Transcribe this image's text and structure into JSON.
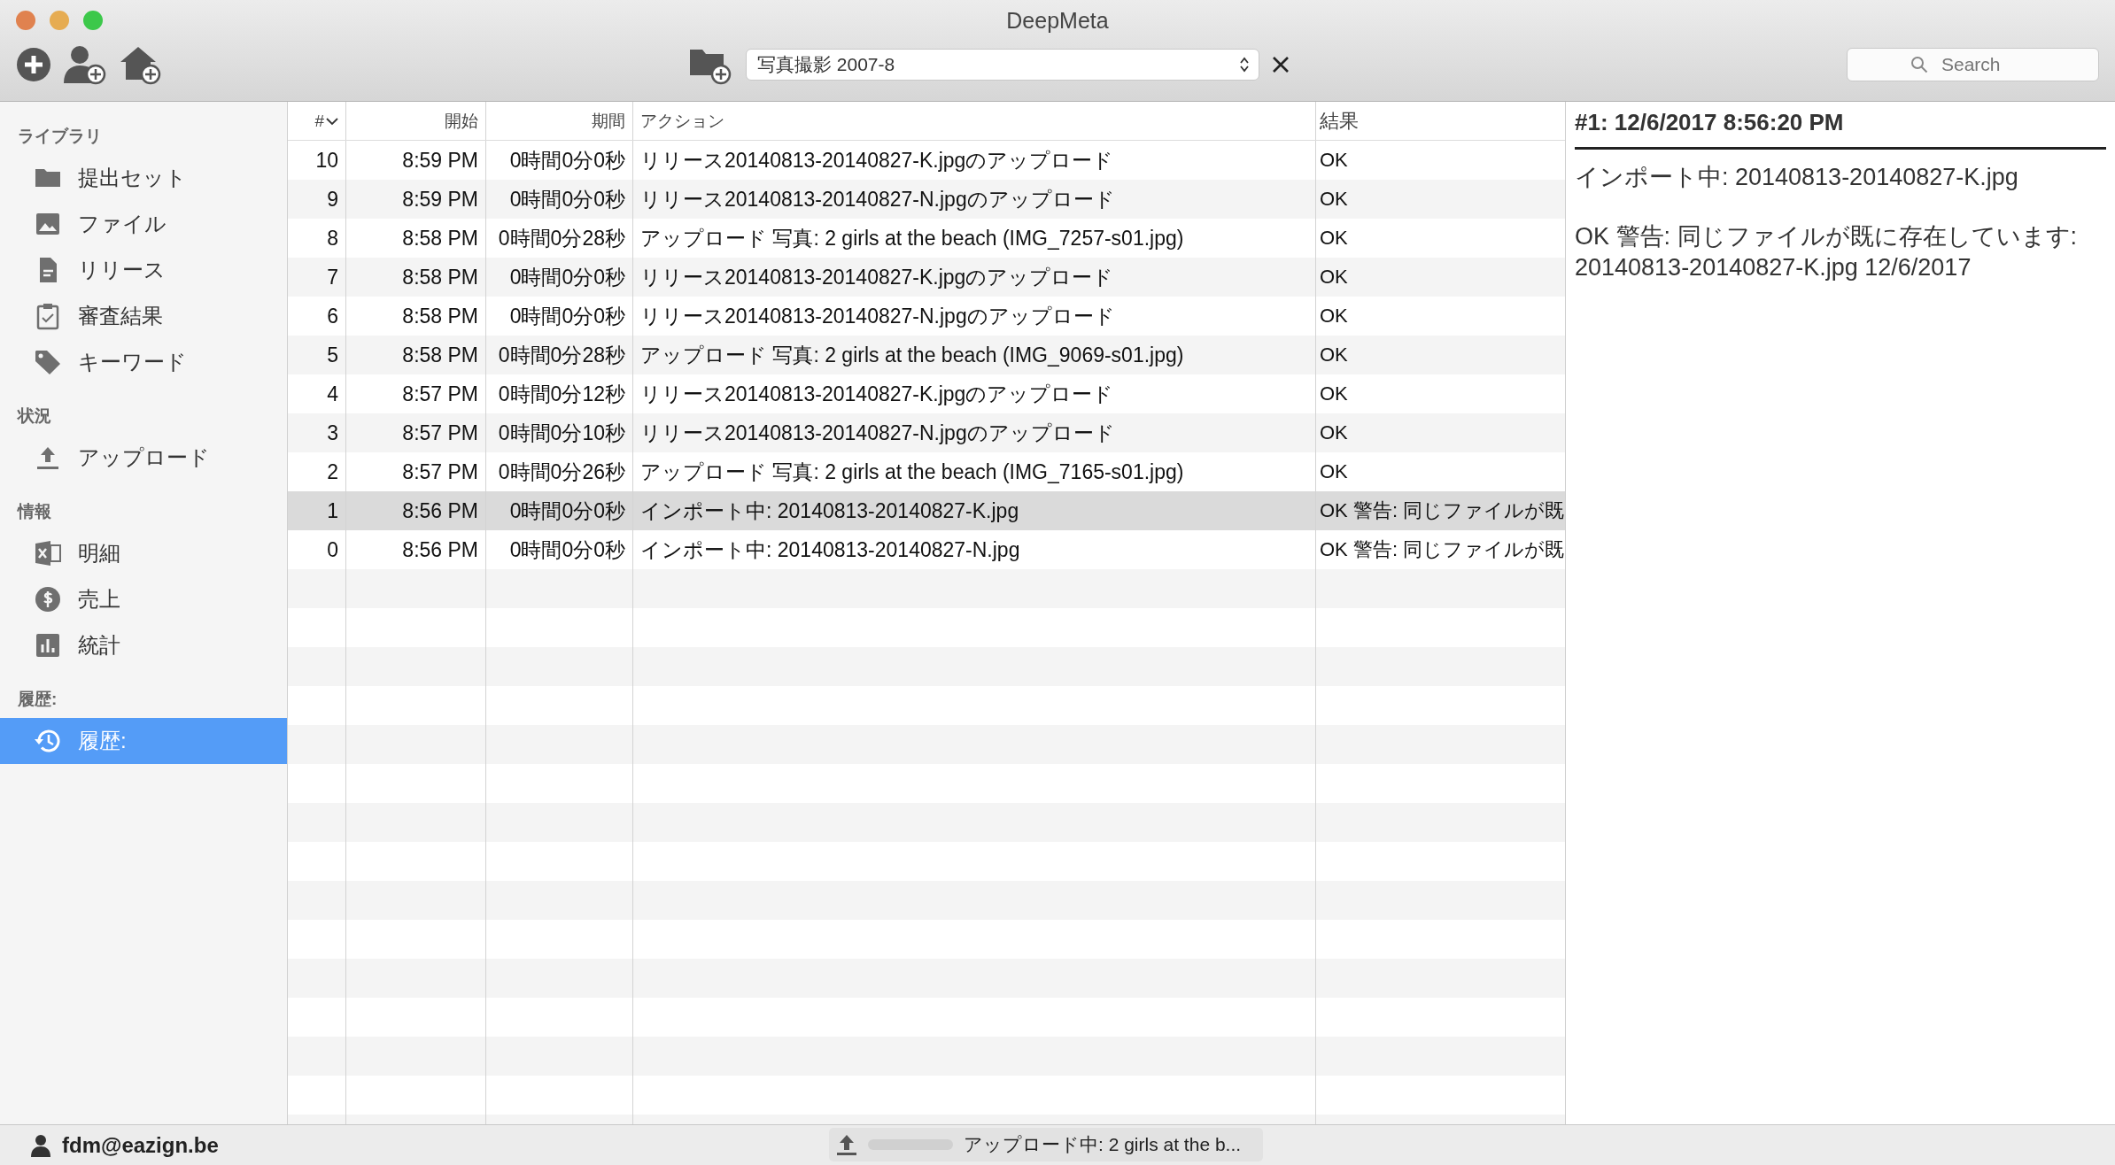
{
  "window": {
    "title": "DeepMeta"
  },
  "toolbar": {
    "collection": "写真撮影 2007-8",
    "search": {
      "placeholder": "Search"
    }
  },
  "sidebar": {
    "sections": [
      {
        "title": "ライブラリ",
        "items": [
          {
            "label": "提出セット",
            "selected": false
          },
          {
            "label": "ファイル",
            "selected": false
          },
          {
            "label": "リリース",
            "selected": false
          },
          {
            "label": "審査結果",
            "selected": false
          },
          {
            "label": "キーワード",
            "selected": false
          }
        ]
      },
      {
        "title": "状況",
        "items": [
          {
            "label": "アップロード",
            "selected": false
          }
        ]
      },
      {
        "title": "情報",
        "items": [
          {
            "label": "明細",
            "selected": false
          },
          {
            "label": "売上",
            "selected": false
          },
          {
            "label": "統計",
            "selected": false
          }
        ]
      },
      {
        "title": "履歴:",
        "items": [
          {
            "label": "履歴:",
            "selected": true
          }
        ]
      }
    ]
  },
  "table": {
    "columns": [
      "#",
      "開始",
      "期間",
      "アクション",
      "結果"
    ],
    "rows": [
      {
        "cells": [
          "10",
          "8:59 PM",
          "0時間0分0秒",
          "リリース20140813-20140827-K.jpgのアップロード",
          "OK"
        ],
        "selected": false
      },
      {
        "cells": [
          "9",
          "8:59 PM",
          "0時間0分0秒",
          "リリース20140813-20140827-N.jpgのアップロード",
          "OK"
        ],
        "selected": false
      },
      {
        "cells": [
          "8",
          "8:58 PM",
          "0時間0分28秒",
          "アップロード 写真: 2 girls at the beach (IMG_7257-s01.jpg)",
          "OK"
        ],
        "selected": false
      },
      {
        "cells": [
          "7",
          "8:58 PM",
          "0時間0分0秒",
          "リリース20140813-20140827-K.jpgのアップロード",
          "OK"
        ],
        "selected": false
      },
      {
        "cells": [
          "6",
          "8:58 PM",
          "0時間0分0秒",
          "リリース20140813-20140827-N.jpgのアップロード",
          "OK"
        ],
        "selected": false
      },
      {
        "cells": [
          "5",
          "8:58 PM",
          "0時間0分28秒",
          "アップロード 写真: 2 girls at the beach (IMG_9069-s01.jpg)",
          "OK"
        ],
        "selected": false
      },
      {
        "cells": [
          "4",
          "8:57 PM",
          "0時間0分12秒",
          "リリース20140813-20140827-K.jpgのアップロード",
          "OK"
        ],
        "selected": false
      },
      {
        "cells": [
          "3",
          "8:57 PM",
          "0時間0分10秒",
          "リリース20140813-20140827-N.jpgのアップロード",
          "OK"
        ],
        "selected": false
      },
      {
        "cells": [
          "2",
          "8:57 PM",
          "0時間0分26秒",
          "アップロード 写真: 2 girls at the beach (IMG_7165-s01.jpg)",
          "OK"
        ],
        "selected": false
      },
      {
        "cells": [
          "1",
          "8:56 PM",
          "0時間0分0秒",
          "インポート中: 20140813-20140827-K.jpg",
          "OK 警告: 同じファイルが既"
        ],
        "selected": true
      },
      {
        "cells": [
          "0",
          "8:56 PM",
          "0時間0分0秒",
          "インポート中: 20140813-20140827-N.jpg",
          "OK 警告: 同じファイルが既"
        ],
        "selected": false
      }
    ]
  },
  "detail": {
    "title": "#1: 12/6/2017 8:56:20 PM",
    "paragraphs": [
      "インポート中: 20140813-20140827-K.jpg",
      "OK 警告: 同じファイルが既に存在しています: 20140813-20140827-K.jpg 12/6/2017"
    ]
  },
  "status_bar": {
    "user": "fdm@eazign.be",
    "upload": {
      "level": 0,
      "text": "アップロード中: 2 girls at the b..."
    }
  }
}
